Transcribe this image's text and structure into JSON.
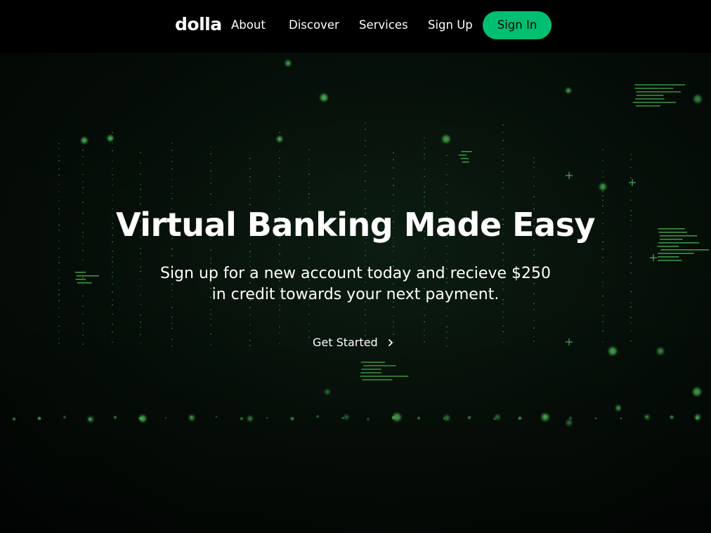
{
  "nav": {
    "logo": "dolla",
    "links": [
      "About",
      "Discover",
      "Services",
      "Sign Up"
    ],
    "signin_label": "Sign In"
  },
  "hero": {
    "title": "Virtual Banking Made Easy",
    "subtitle_line1": "Sign up for a new account today and recieve $250",
    "subtitle_line2": "in credit towards your next payment.",
    "cta_label": "Get Started",
    "cta_icon": "chevron-right-icon"
  },
  "colors": {
    "accent": "#01bf71",
    "nav_bg": "#000000",
    "hero_glow": "#5ee36a"
  }
}
